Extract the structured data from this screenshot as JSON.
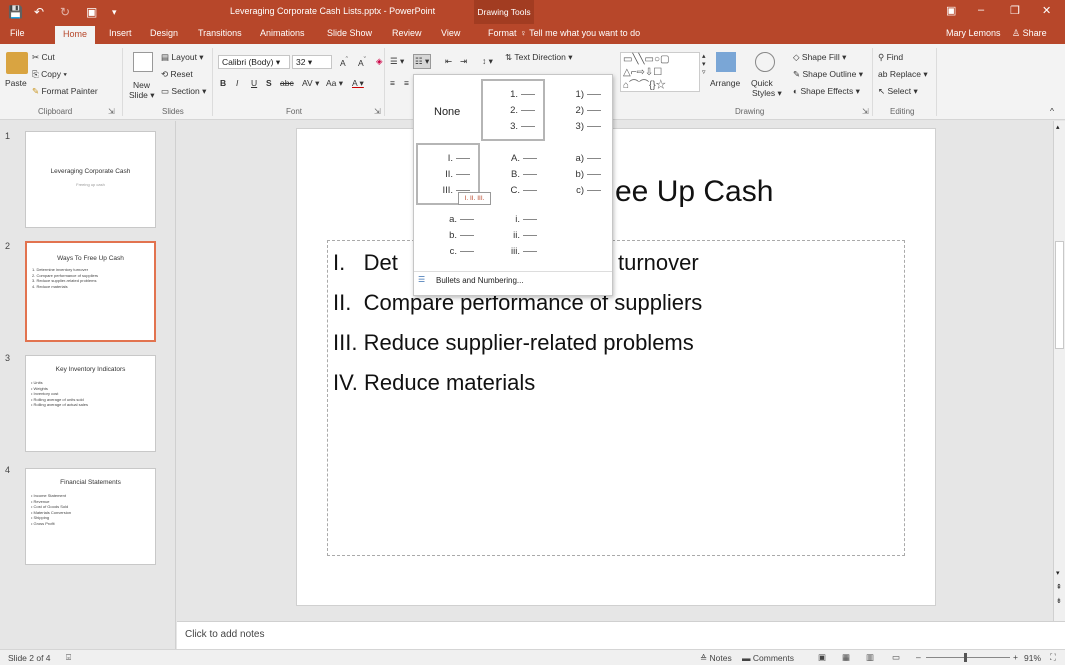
{
  "titlebar": {
    "document_title": "Leveraging Corporate Cash Lists.pptx - PowerPoint",
    "context_tab": "Drawing Tools",
    "user": "Mary Lemons",
    "share": "Share"
  },
  "tabs": [
    "File",
    "Home",
    "Insert",
    "Design",
    "Transitions",
    "Animations",
    "Slide Show",
    "Review",
    "View",
    "Format"
  ],
  "active_tab": "Home",
  "tell_me": "Tell me what you want to do",
  "ribbon": {
    "clipboard": {
      "paste": "Paste",
      "cut": "Cut",
      "copy": "Copy",
      "format_painter": "Format Painter",
      "label": "Clipboard"
    },
    "slides": {
      "new_slide_1": "New",
      "new_slide_2": "Slide",
      "layout": "Layout",
      "reset": "Reset",
      "section": "Section",
      "label": "Slides"
    },
    "font": {
      "name": "Calibri (Body)",
      "size": "32",
      "label": "Font"
    },
    "paragraph": {
      "text_direction": "Text Direction"
    },
    "drawing": {
      "arrange": "Arrange",
      "quick_1": "Quick",
      "quick_2": "Styles",
      "shape_fill": "Shape Fill",
      "shape_outline": "Shape Outline",
      "shape_effects": "Shape Effects",
      "label": "Drawing"
    },
    "editing": {
      "find": "Find",
      "replace": "Replace",
      "select": "Select",
      "label": "Editing"
    }
  },
  "slides": [
    {
      "num": "1",
      "title": "Leveraging Corporate Cash",
      "subtitle": "Freeing up cash",
      "bullets": []
    },
    {
      "num": "2",
      "title": "Ways To Free Up Cash",
      "subtitle": "",
      "bullets": [
        "1.  Determine inventory turnover",
        "2.  Compare performance of suppliers",
        "3.  Reduce supplier-related problems",
        "4.  Reduce materials"
      ]
    },
    {
      "num": "3",
      "title": "Key Inventory Indicators",
      "subtitle": "",
      "bullets": [
        "•  Units",
        "•  Weights",
        "•  Inventory cost",
        "•  Rolling average of units sold",
        "•  Rolling average of actual sales"
      ]
    },
    {
      "num": "4",
      "title": "Financial Statements",
      "subtitle": "",
      "bullets": [
        "•  Income Statement",
        "•  Revenue",
        "•  Cost of Goods Sold",
        "•  Materials Conversion",
        "•  Shipping",
        "•  Gross Profit"
      ]
    }
  ],
  "main_slide": {
    "title_visible": "ee Up Cash",
    "lines": [
      {
        "prefix": "I.",
        "text": "Det",
        "tail": "turnover"
      },
      {
        "prefix": "II.",
        "text": "Compare performance of suppliers"
      },
      {
        "prefix": "III.",
        "text": "Reduce supplier-related problems"
      },
      {
        "prefix": "IV.",
        "text": "Reduce materials"
      }
    ]
  },
  "numbering_gallery": {
    "none": "None",
    "formats": [
      [
        "1.",
        "2.",
        "3."
      ],
      [
        "1)",
        "2)",
        "3)"
      ],
      [
        "I.",
        "II.",
        "III."
      ],
      [
        "A.",
        "B.",
        "C."
      ],
      [
        "a)",
        "b)",
        "c)"
      ],
      [
        "a.",
        "b.",
        "c."
      ],
      [
        "i.",
        "ii.",
        "iii."
      ]
    ],
    "tooltip": "I. II. III.",
    "bullets_and_numbering": "Bullets and Numbering..."
  },
  "notes_placeholder": "Click to add notes",
  "status": {
    "slide": "Slide 2 of 4",
    "notes": "Notes",
    "comments": "Comments",
    "zoom": "91%"
  },
  "colors": {
    "accent": "#b7472a",
    "selection": "#e2734f"
  }
}
